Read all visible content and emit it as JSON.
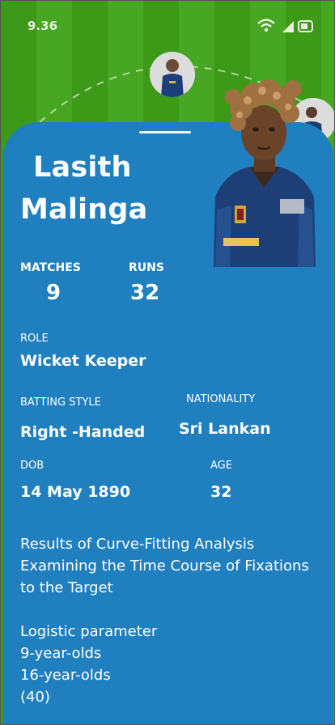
{
  "status_bar": {
    "time": "9.36",
    "icons": [
      "wifi-icon",
      "signal-icon",
      "battery-icon"
    ]
  },
  "colors": {
    "pitch_green": "#3d9a18",
    "card_blue": "#1f7fbf",
    "text": "#ffffff"
  },
  "player": {
    "first_name": "Lasith",
    "last_name": "Malinga"
  },
  "stats": {
    "matches_label": "MATCHES",
    "matches_value": "9",
    "runs_label": "RUNS",
    "runs_value": "32"
  },
  "details": {
    "role_label": "ROLE",
    "role_value": "Wicket Keeper",
    "batting_label": "BATTING STYLE",
    "batting_value": "Right -Handed",
    "nationality_label": "NATIONALITY",
    "nationality_value": "Sri Lankan",
    "dob_label": "DOB",
    "dob_value": "14 May 1890",
    "age_label": "AGE",
    "age_value": "32"
  },
  "description": {
    "line1": "Results of Curve-Fitting Analysis",
    "line2": "Examining the Time Course of Fixations",
    "line3": "to the Target",
    "line4": "Logistic parameter",
    "line5": "9-year-olds",
    "line6": "16-year-olds",
    "line7": "(40)"
  }
}
